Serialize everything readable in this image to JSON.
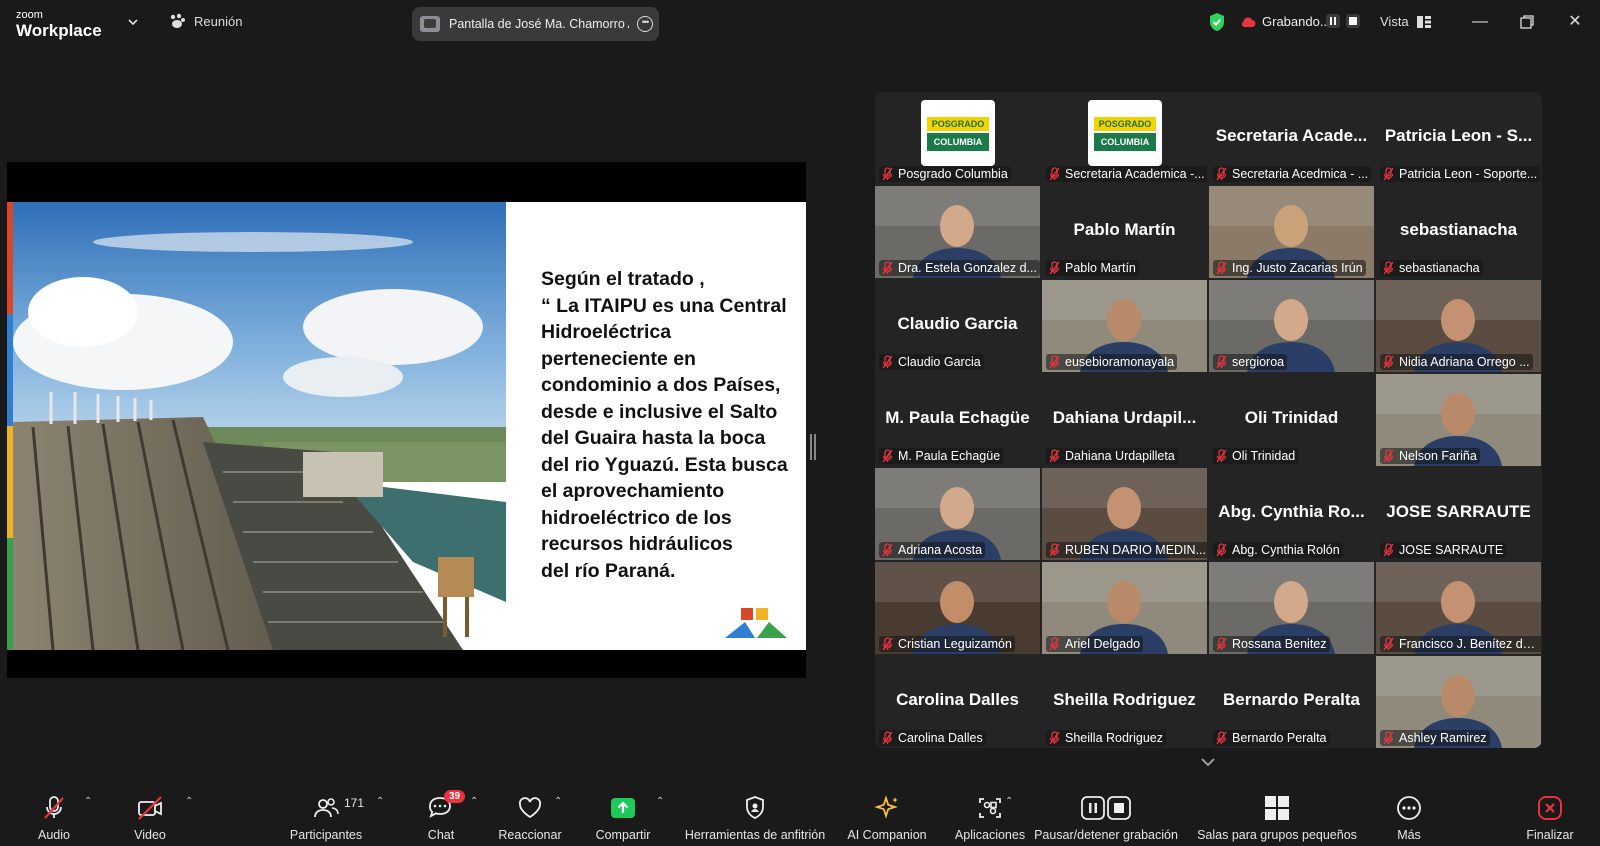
{
  "app": {
    "brand_small": "zoom",
    "brand_large": "Workplace"
  },
  "topbar": {
    "meeting_label": "Reunión",
    "share_label": "Pantalla de José Ma. Chamorro A",
    "recording_label": "Grabando...",
    "view_label": "Vista"
  },
  "slide": {
    "lines": [
      "Según el tratado ,",
      "“ La ITAIPU es una Central",
      "Hidroeléctrica",
      "perteneciente en",
      "condominio a dos Países,",
      "desde e inclusive el Salto",
      "del Guaira  hasta la boca",
      "del rio Yguazú. Esta busca",
      "el aprovechamiento",
      "hidroeléctrico de los",
      "recursos hidráulicos",
      "del río Paraná."
    ]
  },
  "logo_tile": {
    "line1": "POSGRADO",
    "line2": "COLUMBIA"
  },
  "participants": [
    {
      "big": "",
      "label": "Posgrado Columbia",
      "type": "logo"
    },
    {
      "big": "",
      "label": "Secretaria Academica -...",
      "type": "logo"
    },
    {
      "big": "Secretaria  Acade...",
      "label": "Secretaria Acedmica - ...",
      "type": "name"
    },
    {
      "big": "Patricia Leon - S...",
      "label": "Patricia Leon - Soporte...",
      "type": "name"
    },
    {
      "big": "",
      "label": "Dra. Estela Gonzalez d...",
      "type": "video"
    },
    {
      "big": "Pablo Martín",
      "label": "Pablo Martín",
      "type": "name"
    },
    {
      "big": "",
      "label": "Ing. Justo Zacarias Irún",
      "type": "video"
    },
    {
      "big": "sebastianacha",
      "label": "sebastianacha",
      "type": "name"
    },
    {
      "big": "Claudio Garcia",
      "label": "Claudio Garcia",
      "type": "name"
    },
    {
      "big": "",
      "label": "eusebioramonayala",
      "type": "video"
    },
    {
      "big": "",
      "label": "sergioroa",
      "type": "video"
    },
    {
      "big": "",
      "label": "Nidia Adriana Orrego ...",
      "type": "video"
    },
    {
      "big": "M. Paula Echagüe",
      "label": "M. Paula Echagüe",
      "type": "name"
    },
    {
      "big": "Dahiana  Urdapil...",
      "label": "Dahiana Urdapilleta",
      "type": "name"
    },
    {
      "big": "Oli Trinidad",
      "label": "Oli Trinidad",
      "type": "name"
    },
    {
      "big": "",
      "label": "Nelson Fariña",
      "type": "video"
    },
    {
      "big": "",
      "label": "Adriana Acosta",
      "type": "video"
    },
    {
      "big": "",
      "label": "RUBEN DARIO MEDIN...",
      "type": "video"
    },
    {
      "big": "Abg. Cynthia Ro...",
      "label": "Abg. Cynthia Rolón",
      "type": "name"
    },
    {
      "big": "JOSE SARRAUTE",
      "label": "JOSE SARRAUTE",
      "type": "name"
    },
    {
      "big": "",
      "label": "Cristian Leguizamón",
      "type": "video"
    },
    {
      "big": "",
      "label": "Ariel Delgado",
      "type": "video"
    },
    {
      "big": "",
      "label": "Rossana Benitez",
      "type": "video"
    },
    {
      "big": "",
      "label": "Francisco J. Benítez del...",
      "type": "video"
    },
    {
      "big": "Carolina Dalles",
      "label": "Carolina Dalles",
      "type": "name"
    },
    {
      "big": "Sheilla Rodriguez",
      "label": "Sheilla Rodriguez",
      "type": "name"
    },
    {
      "big": "Bernardo Peralta",
      "label": "Bernardo Peralta",
      "type": "name"
    },
    {
      "big": "",
      "label": "Ashley Ramirez",
      "type": "video"
    }
  ],
  "active_speaker": "Ing. Justo Zacarias Irún",
  "toolbar": {
    "audio": "Audio",
    "video": "Video",
    "participants": "Participantes",
    "participants_count": "171",
    "chat": "Chat",
    "chat_badge": "39",
    "react": "Reaccionar",
    "share": "Compartir",
    "host_tools": "Herramientas de anfitrión",
    "ai": "AI Companion",
    "apps": "Aplicaciones",
    "pause_rec": "Pausar/detener grabación",
    "breakout": "Salas para grupos pequeños",
    "more": "Más",
    "end": "Finalizar"
  },
  "colors": {
    "accent_green": "#2fd25a",
    "end_red": "#e8343f",
    "share_green": "#1ec95a"
  }
}
